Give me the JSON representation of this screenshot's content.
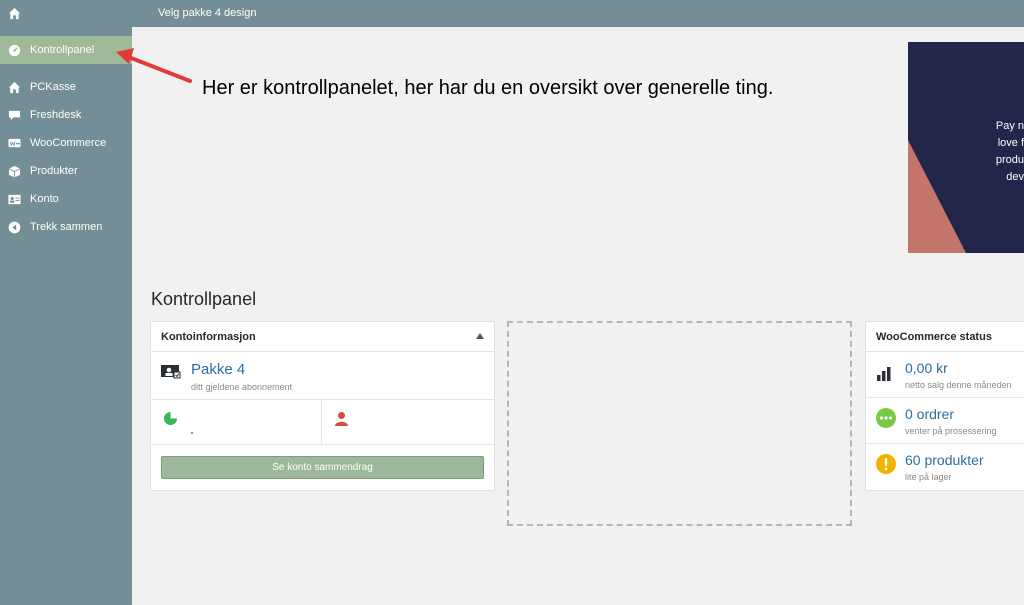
{
  "adminbar": {
    "title": "Velg pakke 4 design",
    "home_icon": "home-icon"
  },
  "sidebar": {
    "items": [
      {
        "label": "Kontrollpanel",
        "icon": "dashboard-icon",
        "active": true
      },
      {
        "label": "PCKasse",
        "icon": "home-icon"
      },
      {
        "label": "Freshdesk",
        "icon": "speech-bubble-icon"
      },
      {
        "label": "WooCommerce",
        "icon": "woocommerce-icon"
      },
      {
        "label": "Produkter",
        "icon": "box-icon"
      },
      {
        "label": "Konto",
        "icon": "id-card-icon"
      },
      {
        "label": "Trekk sammen",
        "icon": "collapse-icon"
      }
    ]
  },
  "annotation": {
    "text": "Her er kontrollpanelet, her har du en oversikt over generelle ting."
  },
  "banner": {
    "lines": [
      "Pay n",
      "love f",
      "produ",
      "dev"
    ]
  },
  "page": {
    "title": "Kontrollpanel"
  },
  "kontoinfo": {
    "title": "Kontoinformasjon",
    "package": "Pakke 4",
    "package_sub": "ditt gjeldene abonnement",
    "button": "Se konto sammendrag"
  },
  "woo": {
    "title": "WooCommerce status",
    "rows": [
      {
        "value": "0,00 kr",
        "sub": "netto salg denne måneden",
        "icon": "bar-chart-icon"
      },
      {
        "value": "0 ordrer",
        "sub": "venter på prosessering",
        "icon": "more-dots-icon"
      },
      {
        "value": "60 produkter",
        "sub": "lite på lager",
        "icon": "warning-icon"
      }
    ]
  },
  "colors": {
    "sidebar": "#738e96",
    "active": "#9eba98",
    "link": "#2e6ca4",
    "banner": "#22264b",
    "accent_red": "#d05050"
  }
}
